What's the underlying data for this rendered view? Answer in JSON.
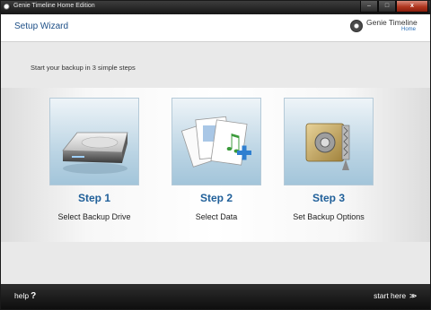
{
  "window": {
    "title": "Genie Timeline Home Edition",
    "controls": {
      "minimize": "–",
      "maximize": "□",
      "close": "x"
    }
  },
  "header": {
    "title": "Setup Wizard",
    "brand_name": "Genie Timeline",
    "brand_edition": "Home"
  },
  "intro_text": "Start your backup in 3 simple steps",
  "steps": [
    {
      "number": "Step 1",
      "label": "Select Backup Drive",
      "icon": "hard-drive-icon"
    },
    {
      "number": "Step 2",
      "label": "Select Data",
      "icon": "documents-music-icon"
    },
    {
      "number": "Step 3",
      "label": "Set Backup Options",
      "icon": "safe-options-icon"
    }
  ],
  "footer": {
    "help_label": "help",
    "help_icon": "?",
    "start_label": "start here",
    "start_icon": ">>"
  },
  "colors": {
    "accent": "#1f5f99",
    "title_blue": "#1c4e86",
    "footer": "#1a1a1a"
  }
}
